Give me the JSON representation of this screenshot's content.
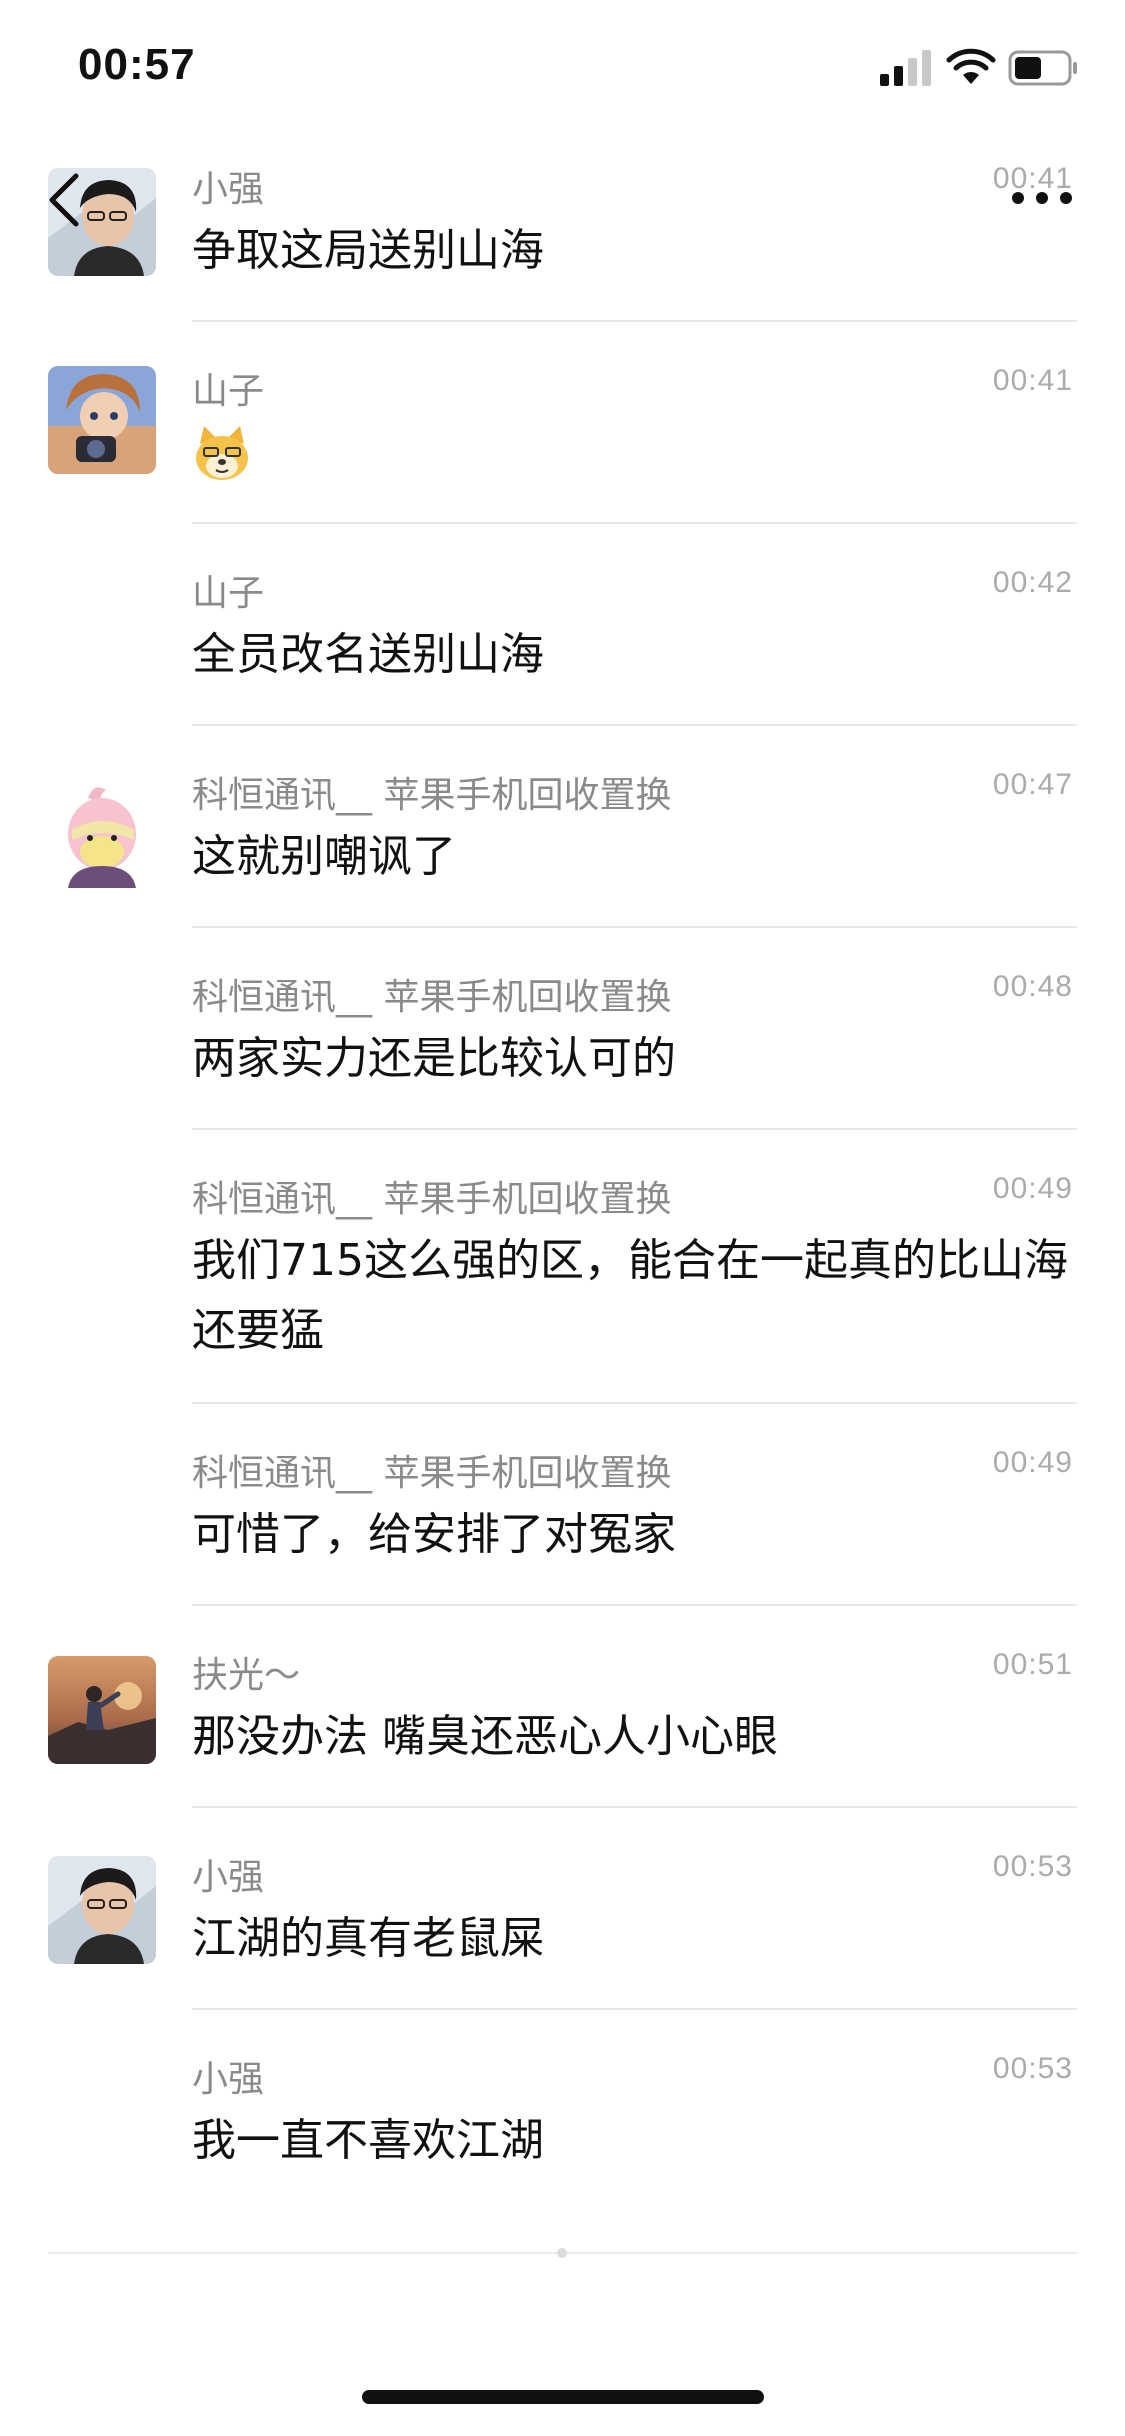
{
  "status_bar": {
    "time": "00:57"
  },
  "icons": {
    "back": "chevron-left-icon",
    "more": "more-dots-icon",
    "signal": "cellular-signal-icon",
    "wifi": "wifi-icon",
    "battery": "battery-icon"
  },
  "messages": [
    {
      "sender": "小强",
      "time": "00:41",
      "text": "争取这局送别山海",
      "avatar": "avatar-xiaoqiang"
    },
    {
      "sender": "山子",
      "time": "00:41",
      "text": "",
      "sticker": "doge-emoji",
      "avatar": "avatar-shanzi"
    },
    {
      "sender": "山子",
      "time": "00:42",
      "text": "全员改名送别山海"
    },
    {
      "sender": "科恒通讯__ 苹果手机回收置换",
      "time": "00:47",
      "text": "这就别嘲讽了",
      "avatar": "avatar-keheng"
    },
    {
      "sender": "科恒通讯__ 苹果手机回收置换",
      "time": "00:48",
      "text": "两家实力还是比较认可的"
    },
    {
      "sender": "科恒通讯__ 苹果手机回收置换",
      "time": "00:49",
      "text": "我们715这么强的区，能合在一起真的比山海还要猛"
    },
    {
      "sender": "科恒通讯__ 苹果手机回收置换",
      "time": "00:49",
      "text": "可惜了，给安排了对冤家"
    },
    {
      "sender": "扶光～",
      "time": "00:51",
      "text": "那没办法 嘴臭还恶心人小心眼",
      "avatar": "avatar-fuguang"
    },
    {
      "sender": "小强",
      "time": "00:53",
      "text": "江湖的真有老鼠屎",
      "avatar": "avatar-xiaoqiang"
    },
    {
      "sender": "小强",
      "time": "00:53",
      "text": "我一直不喜欢江湖"
    }
  ]
}
